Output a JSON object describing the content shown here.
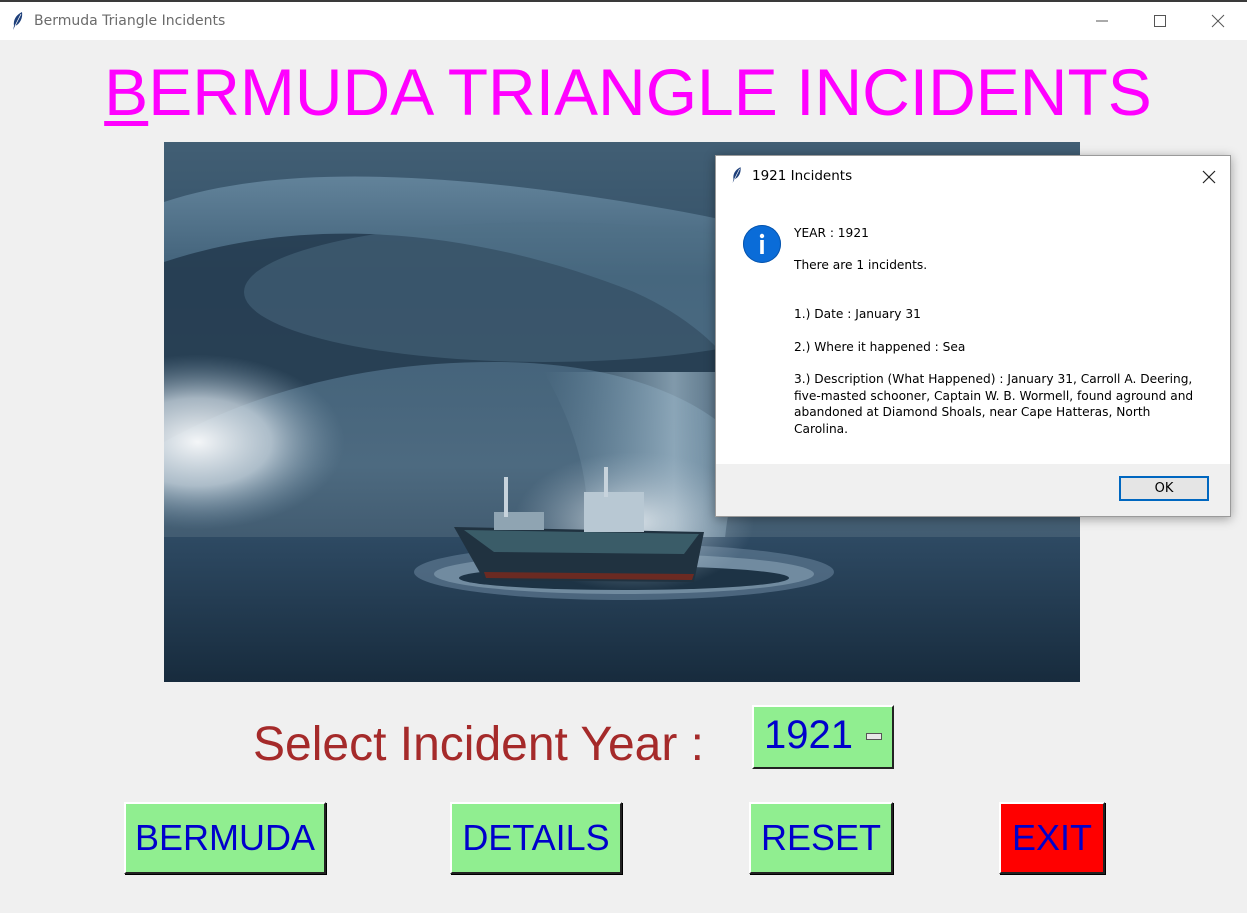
{
  "window": {
    "title": "Bermuda Triangle Incidents"
  },
  "icons": {
    "app": "feather-icon",
    "minimize": "minimize-icon",
    "maximize": "maximize-icon",
    "close": "close-icon",
    "info": "info-icon",
    "spin": "spinbox-arrow-icon"
  },
  "heading": {
    "first_letter": "B",
    "rest": "ERMUDA TRIANGLE INCIDENTS"
  },
  "image": {
    "subject": "storm-whirlpool-ship"
  },
  "select": {
    "label": "Select Incident Year  :",
    "value": "1921"
  },
  "buttons": {
    "bermuda": "BERMUDA",
    "details": "DETAILS",
    "reset": "RESET",
    "exit": "EXIT"
  },
  "dialog": {
    "title": "1921 Incidents",
    "year_line": "YEAR  :  1921",
    "count_line": "There are  1  incidents.",
    "date_line": "1.)  Date  :  January 31",
    "where_line": "2.)  Where it happened  :  Sea",
    "description_line": "3.)  Description (What Happened)  :  January 31, Carroll A. Deering, five-masted schooner, Captain W. B. Wormell, found aground and abandoned at Diamond Shoals, near Cape Hatteras, North Carolina.",
    "ok_label": "OK"
  },
  "colors": {
    "heading": "#ff00ff",
    "label": "#a52a2a",
    "button_bg": "#90ee90",
    "button_text": "#0000cc",
    "exit_bg": "#ff0000",
    "ok_border": "#0067c0",
    "info_blue": "#0a6cd8"
  }
}
